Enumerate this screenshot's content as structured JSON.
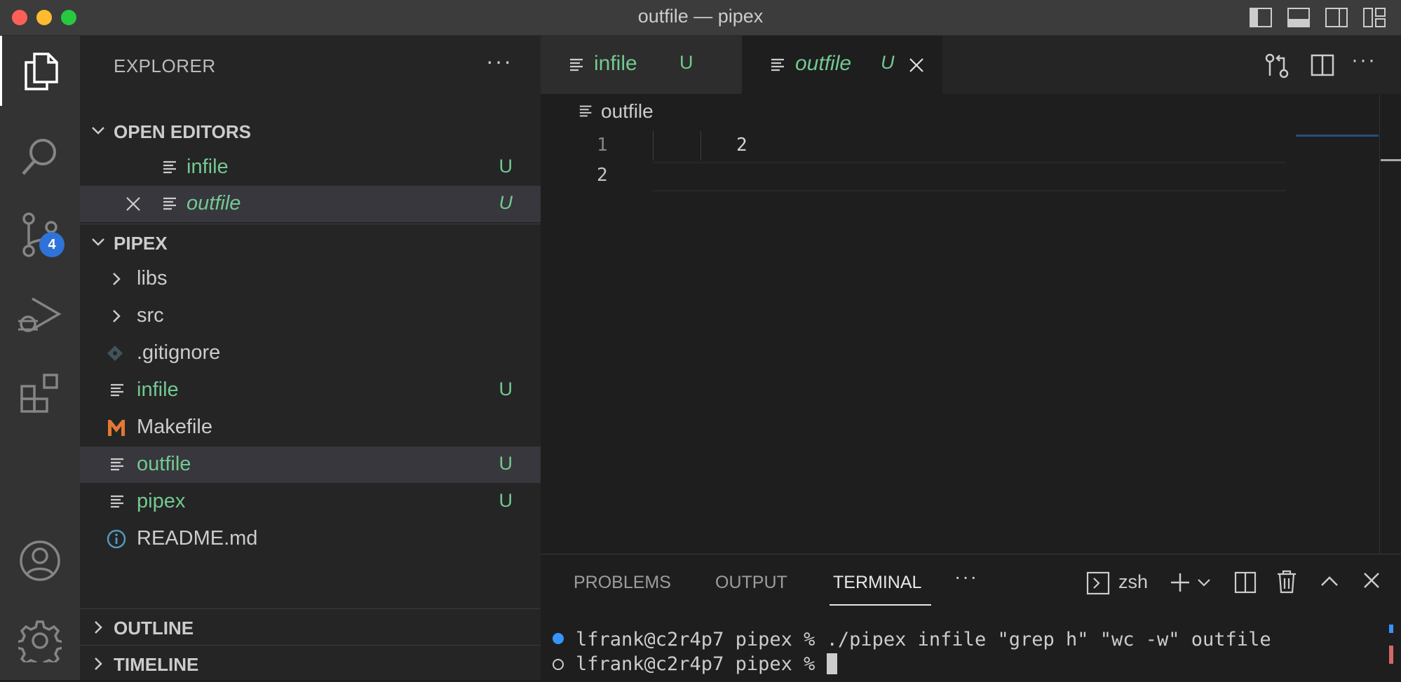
{
  "window": {
    "title": "outfile — pipex",
    "colors": {
      "close": "#ff5f57",
      "minimize": "#febc2e",
      "maximize": "#28c840"
    }
  },
  "activity_bar": {
    "items": [
      "explorer-icon",
      "search-icon",
      "source-control-icon",
      "run-debug-icon",
      "extensions-icon",
      "account-icon",
      "settings-gear-icon"
    ],
    "source_control_badge": "4"
  },
  "sidebar": {
    "title": "EXPLORER",
    "more": "···",
    "open_editors": {
      "label": "OPEN EDITORS",
      "items": [
        {
          "name": "infile",
          "status": "U"
        },
        {
          "name": "outfile",
          "status": "U"
        }
      ]
    },
    "project": {
      "label": "PIPEX",
      "items": [
        {
          "name": "libs",
          "type": "folder"
        },
        {
          "name": "src",
          "type": "folder"
        },
        {
          "name": ".gitignore",
          "type": "file"
        },
        {
          "name": "infile",
          "type": "file",
          "status": "U"
        },
        {
          "name": "Makefile",
          "type": "file"
        },
        {
          "name": "outfile",
          "type": "file",
          "status": "U"
        },
        {
          "name": "pipex",
          "type": "file",
          "status": "U"
        },
        {
          "name": "README.md",
          "type": "file"
        }
      ]
    },
    "outline_label": "OUTLINE",
    "timeline_label": "TIMELINE"
  },
  "editor": {
    "tabs": [
      {
        "name": "infile",
        "status": "U"
      },
      {
        "name": "outfile",
        "status": "U"
      }
    ],
    "breadcrumb": "outfile",
    "lines": [
      {
        "number": "1",
        "content": "2"
      },
      {
        "number": "2",
        "content": ""
      }
    ],
    "more": "···"
  },
  "panel": {
    "tabs": [
      "PROBLEMS",
      "OUTPUT",
      "TERMINAL"
    ],
    "more": "···",
    "shell": "zsh",
    "terminal": [
      "lfrank@c2r4p7 pipex % ./pipex infile \"grep h\" \"wc -w\" outfile",
      "lfrank@c2r4p7 pipex % "
    ]
  }
}
